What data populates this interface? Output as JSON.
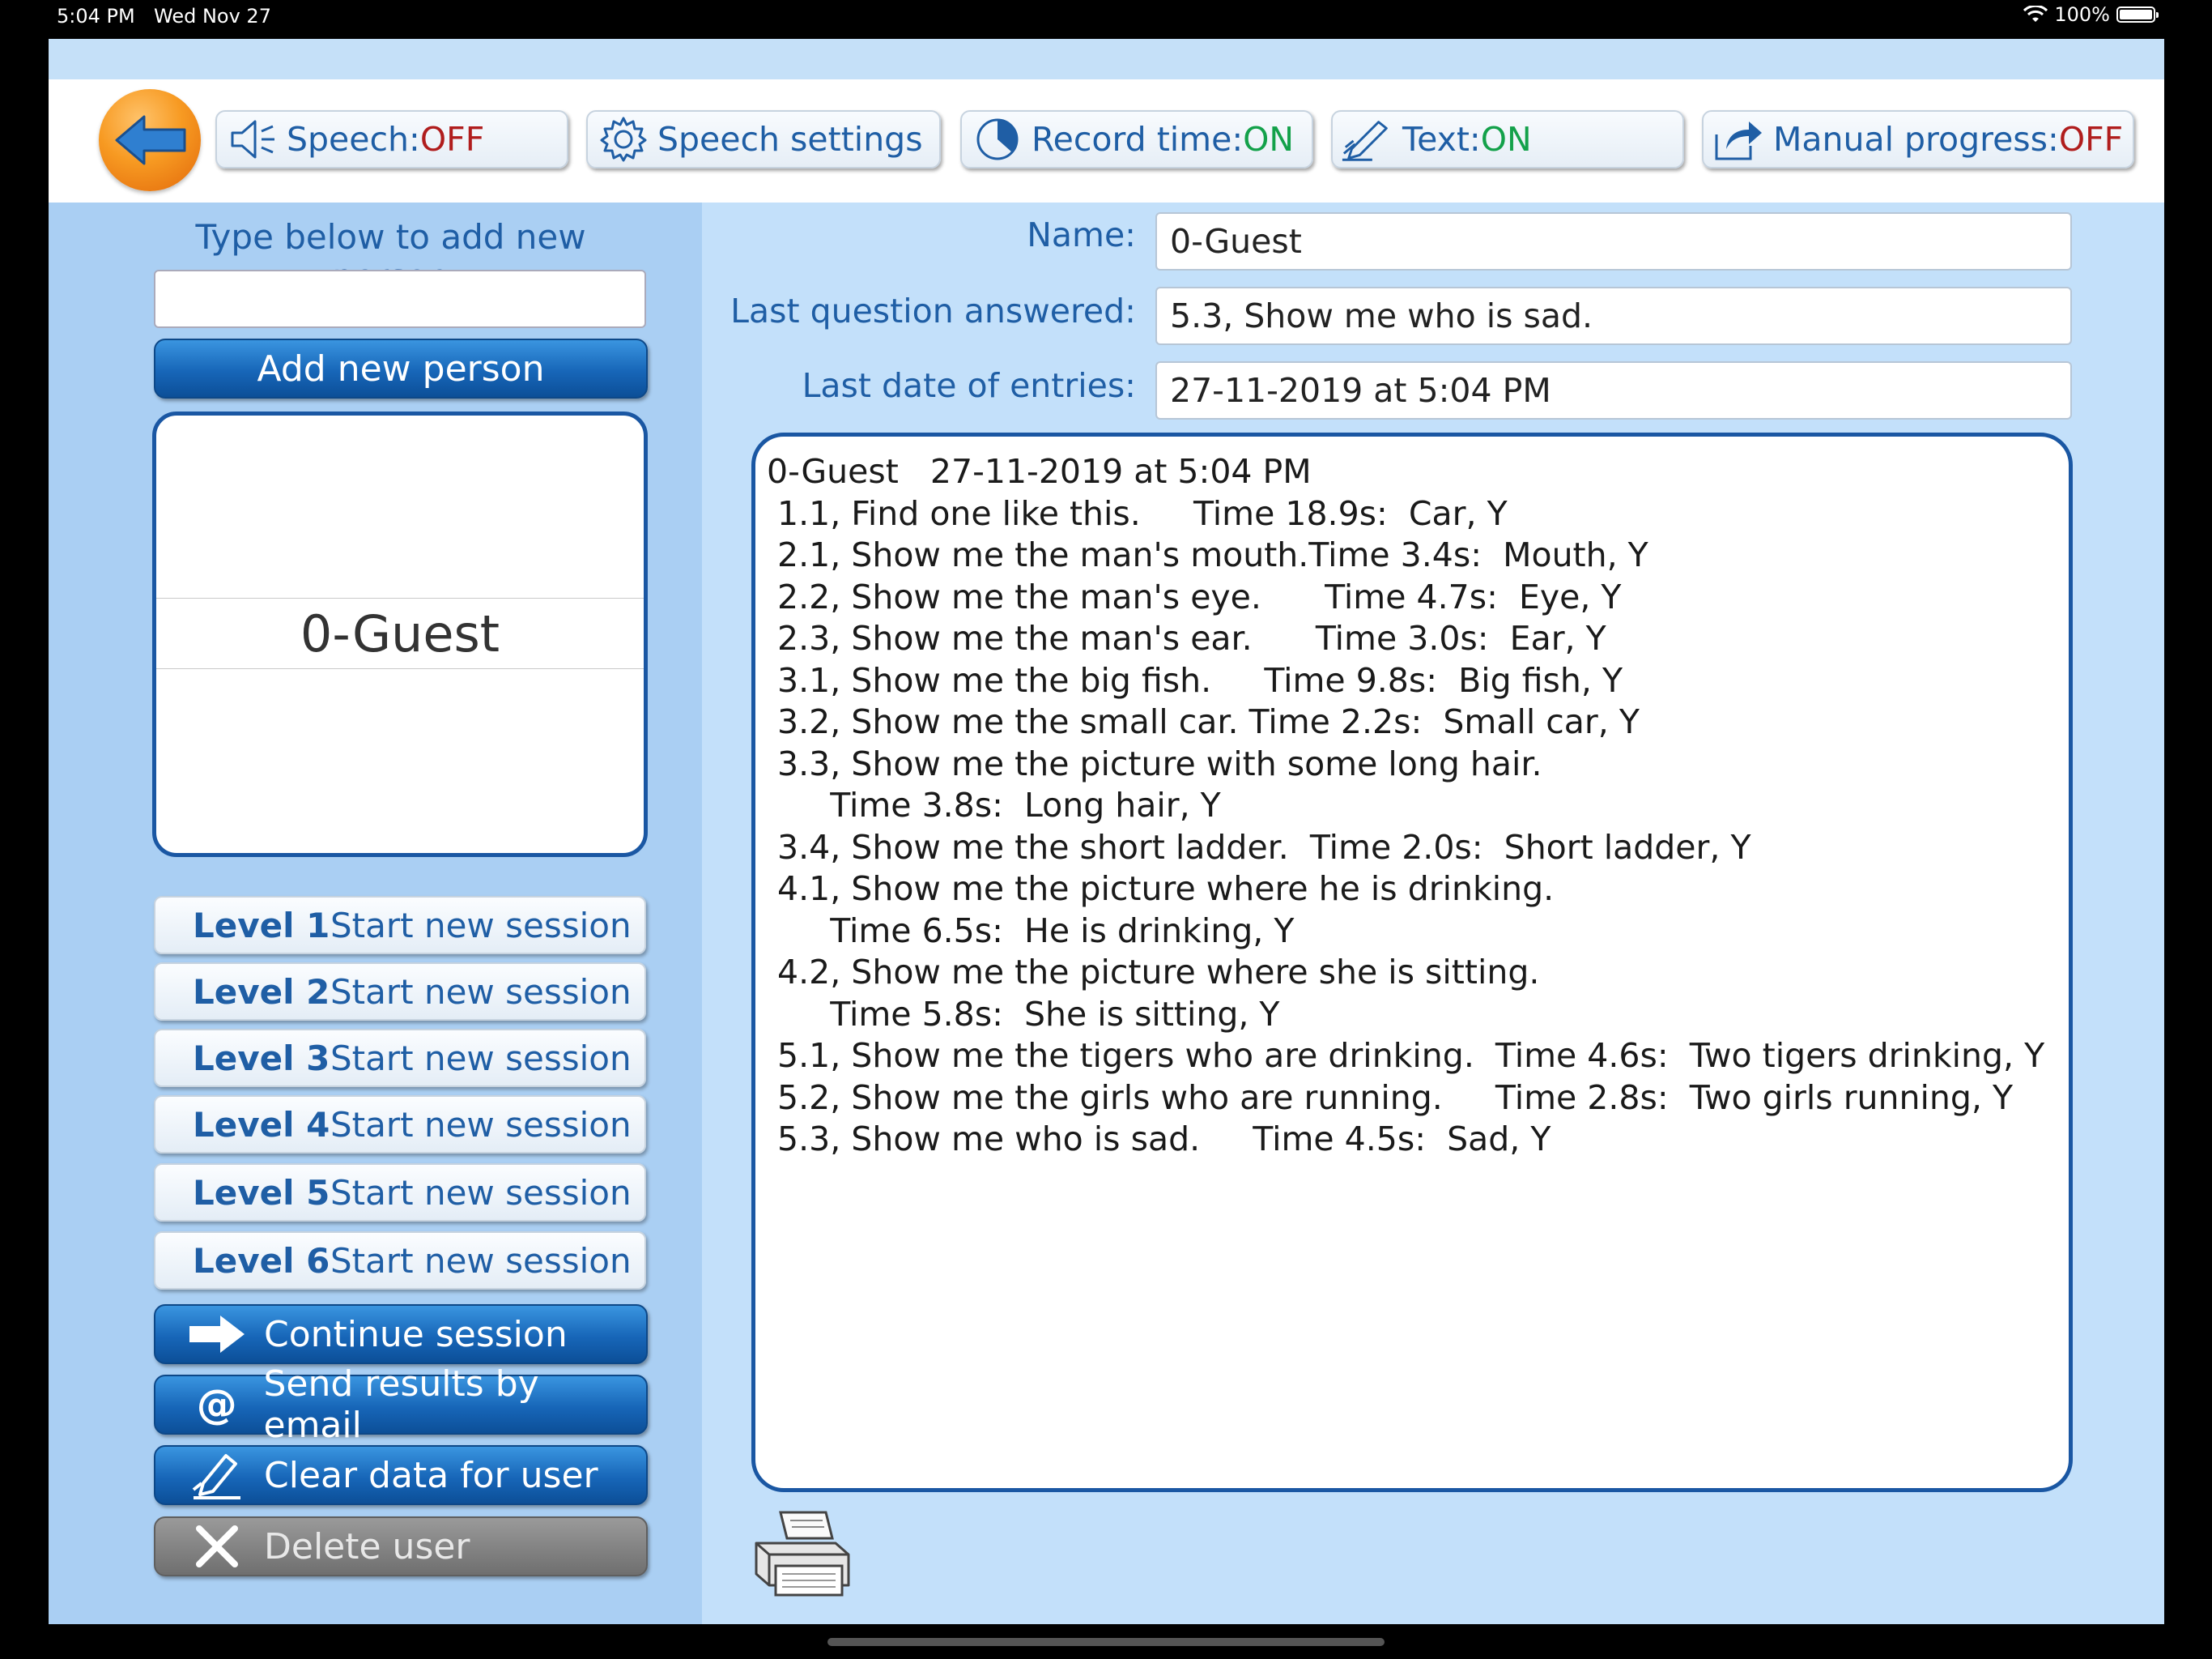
{
  "status_bar": {
    "time": "5:04 PM",
    "date": "Wed Nov 27",
    "battery": "100%"
  },
  "toolbar": {
    "speech_label": "Speech: ",
    "speech_value": "OFF",
    "speech_settings_label": "Speech settings",
    "record_time_label": "Record time: ",
    "record_time_value": "ON",
    "text_label": "Text: ",
    "text_value": "ON",
    "manual_progress_label": "Manual progress: ",
    "manual_progress_value": "OFF"
  },
  "left": {
    "new_person_label": "Type below to add new person",
    "new_person_value": "",
    "add_person_label": "Add new person",
    "people": [
      "0-Guest"
    ],
    "levels": [
      {
        "level": "Level 1",
        "action": "Start new session"
      },
      {
        "level": "Level 2",
        "action": "Start new session"
      },
      {
        "level": "Level 3",
        "action": "Start new session"
      },
      {
        "level": "Level 4",
        "action": "Start new session"
      },
      {
        "level": "Level 5",
        "action": "Start new session"
      },
      {
        "level": "Level 6",
        "action": "Start new session"
      }
    ],
    "continue_label": "Continue session",
    "email_label": "Send results by email",
    "clear_label": "Clear data for user",
    "delete_label": "Delete user"
  },
  "details": {
    "name_label": "Name:",
    "name_value": "0-Guest",
    "last_question_label": "Last question answered:",
    "last_question_value": "5.3, Show me who is sad.",
    "last_date_label": "Last date of entries:",
    "last_date_value": "27-11-2019 at 5:04 PM"
  },
  "log": {
    "lines": [
      "0-Guest   27-11-2019 at 5:04 PM",
      "",
      " 1.1, Find one like this.     Time 18.9s:  Car, Y",
      " 2.1, Show me the man's mouth.Time 3.4s:  Mouth, Y",
      " 2.2, Show me the man's eye.      Time 4.7s:  Eye, Y",
      " 2.3, Show me the man's ear.      Time 3.0s:  Ear, Y",
      " 3.1, Show me the big fish.     Time 9.8s:  Big fish, Y",
      " 3.2, Show me the small car. Time 2.2s:  Small car, Y",
      " 3.3, Show me the picture with some long hair.",
      "      Time 3.8s:  Long hair, Y",
      " 3.4, Show me the short ladder.  Time 2.0s:  Short ladder, Y",
      " 4.1, Show me the picture where he is drinking.",
      "      Time 6.5s:  He is drinking, Y",
      " 4.2, Show me the picture where she is sitting.",
      "      Time 5.8s:  She is sitting, Y",
      " 5.1, Show me the tigers who are drinking.  Time 4.6s:  Two tigers drinking, Y",
      " 5.2, Show me the girls who are running.     Time 2.8s:  Two girls running, Y",
      " 5.3, Show me who is sad.     Time 4.5s:  Sad, Y"
    ]
  }
}
